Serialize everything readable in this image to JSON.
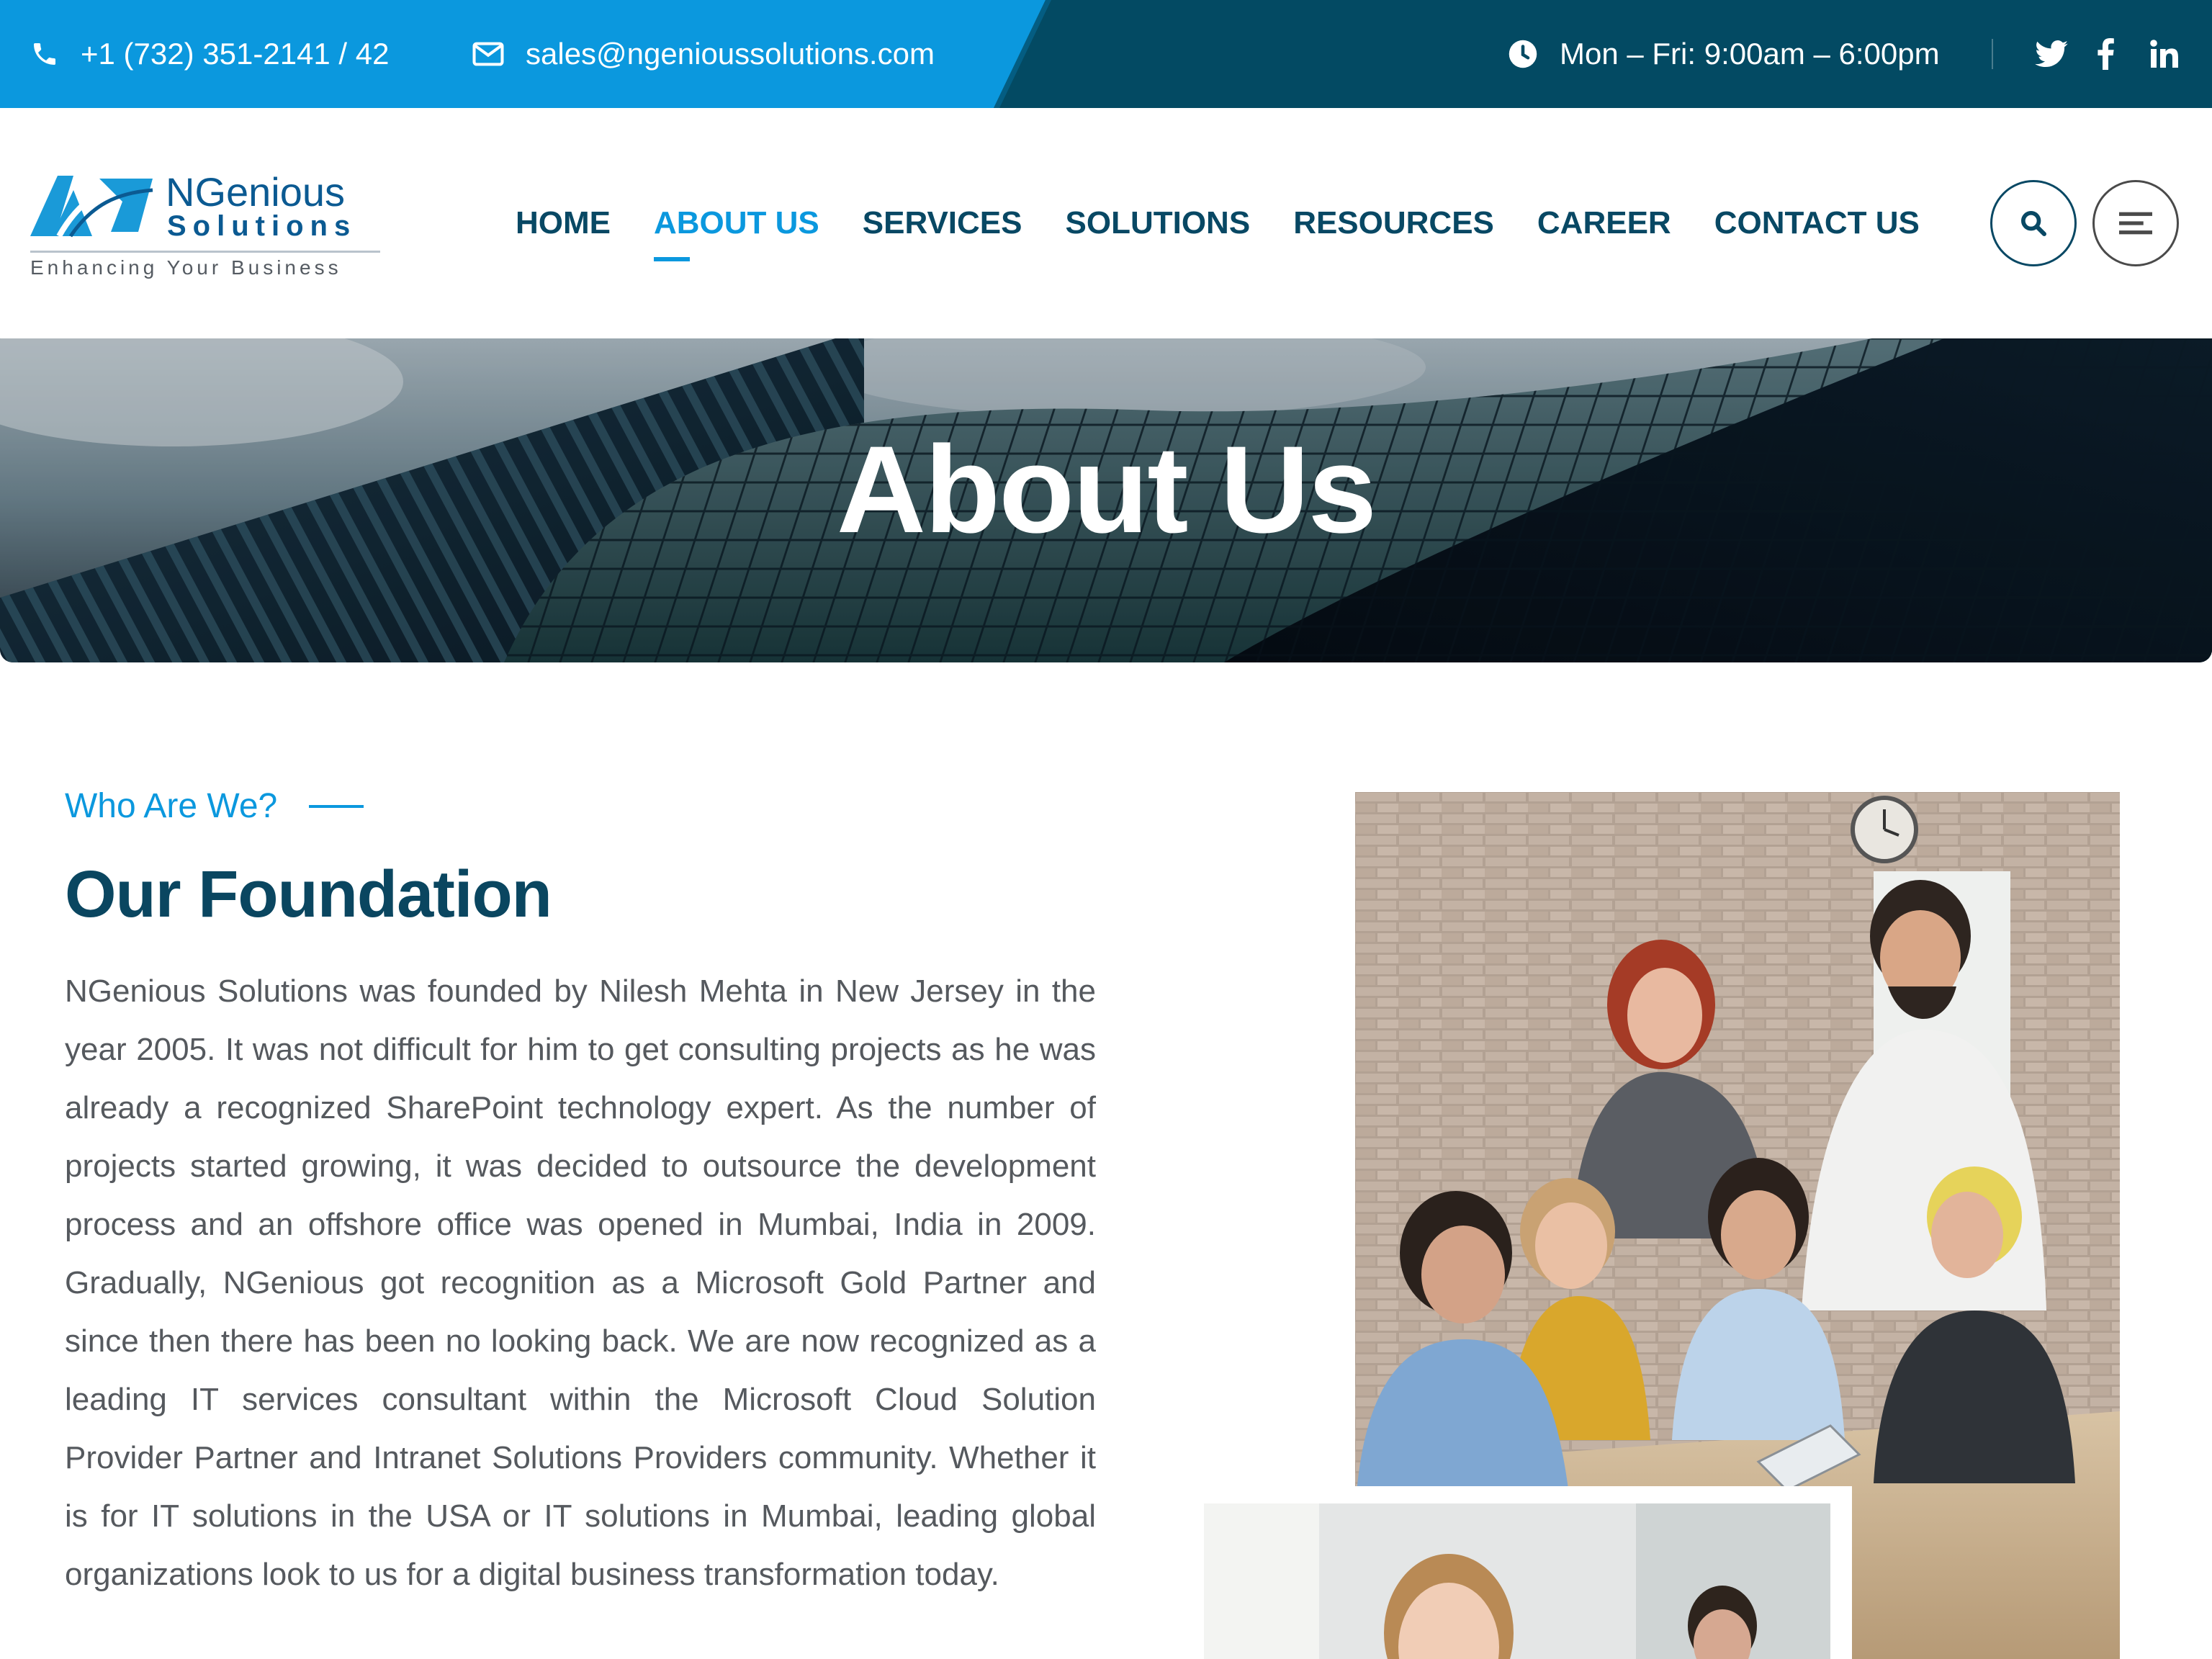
{
  "topbar": {
    "phone": "+1 (732) 351-2141 / 42",
    "email": "sales@ngenioussolutions.com",
    "hours": "Mon – Fri: 9:00am – 6:00pm",
    "icons": [
      "phone-icon",
      "envelope-icon",
      "clock-icon",
      "twitter-icon",
      "facebook-icon",
      "linkedin-icon"
    ],
    "colors": {
      "left": "#0b98de",
      "right": "#034a63"
    }
  },
  "logo": {
    "word1": "NGenious",
    "word2": "Solutions",
    "tagline": "Enhancing Your Business"
  },
  "nav": {
    "items": [
      "HOME",
      "ABOUT US",
      "SERVICES",
      "SOLUTIONS",
      "RESOURCES",
      "CAREER",
      "CONTACT US"
    ],
    "active": "ABOUT US",
    "colors": {
      "default": "#084864",
      "active": "#0b98de"
    },
    "buttons": [
      "search-icon",
      "menu-icon"
    ]
  },
  "banner": {
    "title": "About Us"
  },
  "section": {
    "eyebrow": "Who Are We?",
    "heading": "Our Foundation",
    "body": "NGenious Solutions was founded by Nilesh Mehta in New Jersey in the year 2005. It was not difficult for him to get consulting projects as he was already a recognized SharePoint technology expert. As the number of projects started growing, it was decided to outsource the development process and an offshore office was opened in Mumbai, India in 2009. Gradually, NGenious got recognition as a Microsoft Gold Partner and since then there has been no looking back. We are now recognized as a leading IT services consultant within the Microsoft Cloud Solution Provider Partner and Intranet Solutions Providers community. Whether it is for IT solutions in the USA or IT solutions in Mumbai, leading global organizations look to us for a digital business transformation today.",
    "colors": {
      "eyebrow": "#0b98de",
      "heading": "#0a4660",
      "body": "#55595e"
    }
  }
}
